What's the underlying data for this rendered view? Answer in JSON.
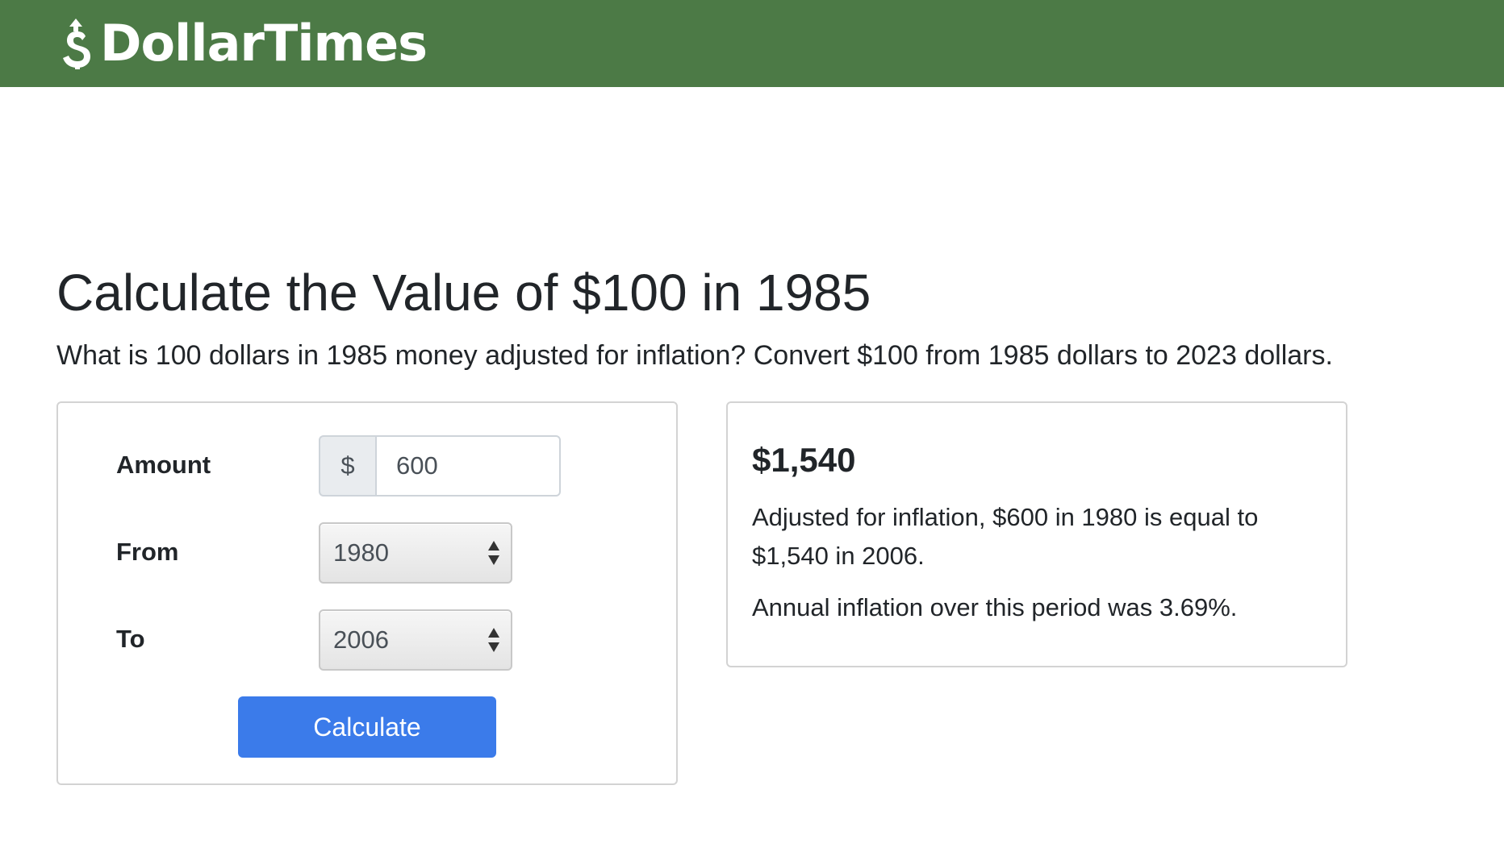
{
  "header": {
    "logo_text": "DollarTimes",
    "brand_color": "#4c7a46"
  },
  "main": {
    "title": "Calculate the Value of $100 in 1985",
    "subtitle": "What is 100 dollars in 1985 money adjusted for inflation? Convert $100 from 1985 dollars to 2023 dollars."
  },
  "form": {
    "amount_label": "Amount",
    "currency_prefix": "$",
    "amount_value": "600",
    "from_label": "From",
    "from_value": "1980",
    "to_label": "To",
    "to_value": "2006",
    "calculate_label": "Calculate",
    "button_color": "#3b7bea"
  },
  "result": {
    "amount": "$1,540",
    "description": "Adjusted for inflation, $600 in 1980 is equal to $1,540 in 2006.",
    "inflation": "Annual inflation over this period was 3.69%."
  }
}
